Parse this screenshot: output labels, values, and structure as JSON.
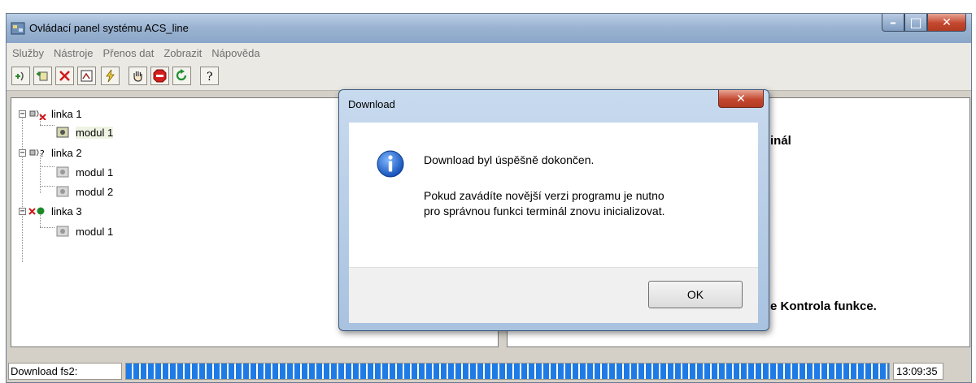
{
  "window": {
    "title": "Ovládací panel systému ACS_line",
    "minimize": "–",
    "maximize": "□",
    "close": "✕"
  },
  "menu": [
    "Služby",
    "Nástroje",
    "Přenos dat",
    "Zobrazit",
    "Nápověda"
  ],
  "toolbar": {
    "icons": [
      "add-line-icon",
      "add-module-icon",
      "delete-icon",
      "properties-icon",
      "lightning-icon",
      "hand-stop-icon",
      "stop-sign-icon",
      "refresh-arrow-icon",
      "help-icon"
    ]
  },
  "tree": {
    "lines": [
      {
        "label": "linka 1",
        "status": "error",
        "modules": [
          "modul 1"
        ]
      },
      {
        "label": "linka 2",
        "status": "unknown",
        "modules": [
          "modul 1",
          "modul 2"
        ]
      },
      {
        "label": "linka 3",
        "status": "ok",
        "modules": [
          "modul 1"
        ]
      }
    ]
  },
  "right_panel": {
    "text_top": "inál",
    "text_bottom": "e Kontrola funkce."
  },
  "statusbar": {
    "label": "Download fs2:",
    "progress": 1.0,
    "time": "13:09:35"
  },
  "dialog": {
    "title": "Download",
    "close": "✕",
    "line1": "Download byl úspěšně dokončen.",
    "line2": "Pokud zavádíte novější verzi programu je nutno",
    "line3": "pro správnou funkci terminál znovu inicializovat.",
    "ok": "OK",
    "icon": "info-icon"
  }
}
